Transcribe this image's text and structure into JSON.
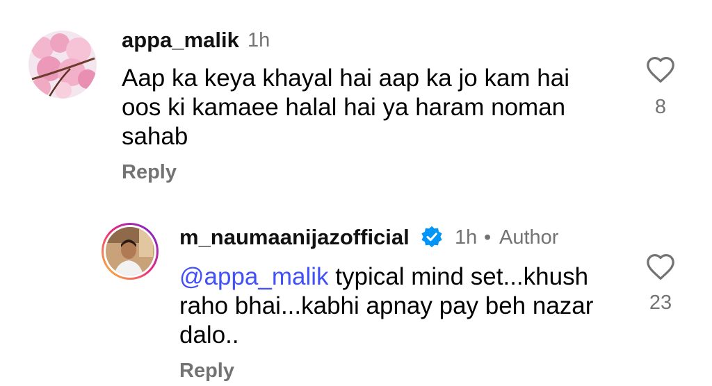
{
  "comments": [
    {
      "username": "appa_malik",
      "time": "1h",
      "text": "Aap ka keya khayal hai aap ka jo kam hai oos ki kamaee halal hai ya haram noman sahab",
      "reply_label": "Reply",
      "likes": "8"
    },
    {
      "username": "m_naumaanijazofficial",
      "time": "1h",
      "separator": "•",
      "role": "Author",
      "mention": "@appa_malik",
      "text": "typical mind set...khush raho bhai...kabhi apnay pay beh nazar dalo..",
      "reply_label": "Reply",
      "likes": "23",
      "verified": true
    }
  ],
  "colors": {
    "mention": "#4150F7",
    "meta": "#737373",
    "verified": "#0095F6"
  },
  "icons": [
    "heart-outline-icon",
    "verified-badge-icon"
  ]
}
